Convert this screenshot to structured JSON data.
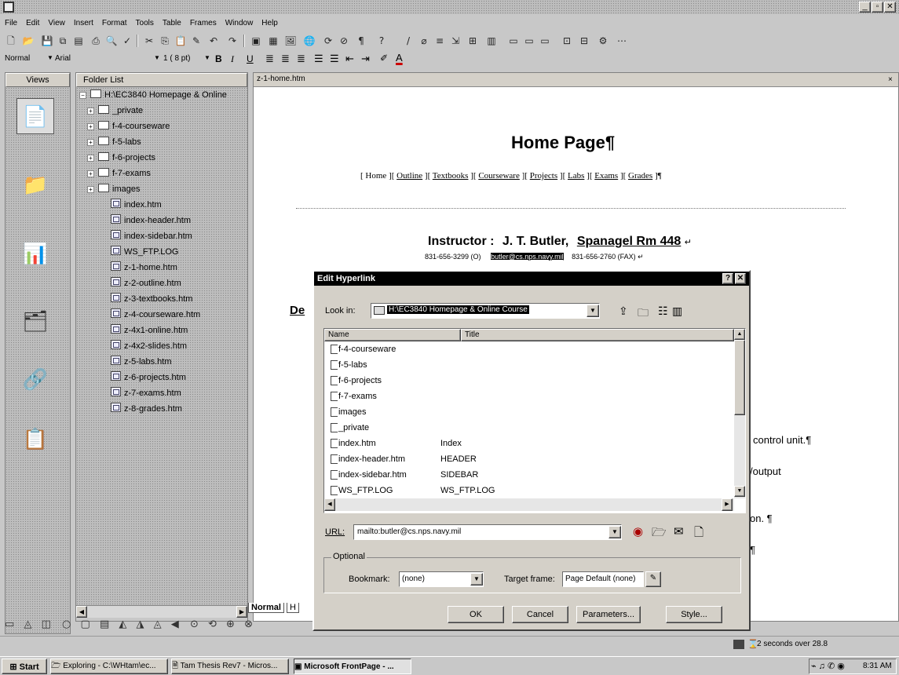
{
  "app": {
    "title_bar_controls": "_ |∂|x"
  },
  "menu": [
    "File",
    "Edit",
    "View",
    "Insert",
    "Format",
    "Tools",
    "Table",
    "Frames",
    "Window",
    "Help"
  ],
  "format_bar": {
    "style": "Normal",
    "font": "Arial",
    "size": "1 ( 8 pt)"
  },
  "views_header": "Views",
  "folder_header": "Folder List",
  "tree": {
    "root": "H:\\EC3840 Homepage & Online",
    "folders": [
      "_private",
      "f-4-courseware",
      "f-5-labs",
      "f-6-projects",
      "f-7-exams",
      "images"
    ],
    "files": [
      "index.htm",
      "index-header.htm",
      "index-sidebar.htm",
      "WS_FTP.LOG",
      "z-1-home.htm",
      "z-2-outline.htm",
      "z-3-textbooks.htm",
      "z-4-courseware.htm",
      "z-4x1-online.htm",
      "z-4x2-slides.htm",
      "z-5-labs.htm",
      "z-6-projects.htm",
      "z-7-exams.htm",
      "z-8-grades.htm"
    ]
  },
  "doc": {
    "tab": "z-1-home.htm",
    "heading": "Home Page¶",
    "nav": [
      "Home",
      "Outline",
      "Textbooks",
      "Courseware",
      "Projects",
      "Labs",
      "Exams",
      "Grades"
    ],
    "instructor_label": "Instructor :",
    "instructor_value": "J. T. Butler,",
    "instructor_room": "Spanagel Rm 448",
    "phone": "831-656-3299 (O)",
    "email": "butler@cs.nps.navy.mil",
    "fax": "831-656-2760 (FAX)",
    "partial_heading": "De",
    "right_1": "control unit.¶",
    "right_2": "/output",
    "right_3": "on. ¶",
    "right_4": "¶",
    "view_tab_normal": "Normal",
    "view_tab_h": "H"
  },
  "dialog": {
    "title": "Edit Hyperlink",
    "help_close": "? X",
    "look_in_label": "Look in:",
    "look_in_value": "H:\\EC3840 Homepage & Online Course",
    "col_name": "Name",
    "col_title": "Title",
    "rows": [
      {
        "name": "f-4-courseware",
        "title": ""
      },
      {
        "name": "f-5-labs",
        "title": ""
      },
      {
        "name": "f-6-projects",
        "title": ""
      },
      {
        "name": "f-7-exams",
        "title": ""
      },
      {
        "name": "images",
        "title": ""
      },
      {
        "name": "_private",
        "title": ""
      },
      {
        "name": "index.htm",
        "title": "Index"
      },
      {
        "name": "index-header.htm",
        "title": "HEADER"
      },
      {
        "name": "index-sidebar.htm",
        "title": "SIDEBAR"
      },
      {
        "name": "WS_FTP.LOG",
        "title": "WS_FTP.LOG"
      }
    ],
    "url_label": "URL:",
    "url_value": "mailto:butler@cs.nps.navy.mil",
    "optional_label": "Optional",
    "bookmark_label": "Bookmark:",
    "bookmark_value": "(none)",
    "target_label": "Target frame:",
    "target_value": "Page Default (none)",
    "ok": "OK",
    "cancel": "Cancel",
    "parameters": "Parameters...",
    "style": "Style..."
  },
  "status": {
    "download": "2 seconds over 28.8"
  },
  "taskbar": {
    "start": "Start",
    "tasks": [
      "Exploring - C:\\WHtam\\ec...",
      "Tam Thesis Rev7 - Micros...",
      "Microsoft FrontPage - ..."
    ],
    "clock": "8:31 AM"
  }
}
